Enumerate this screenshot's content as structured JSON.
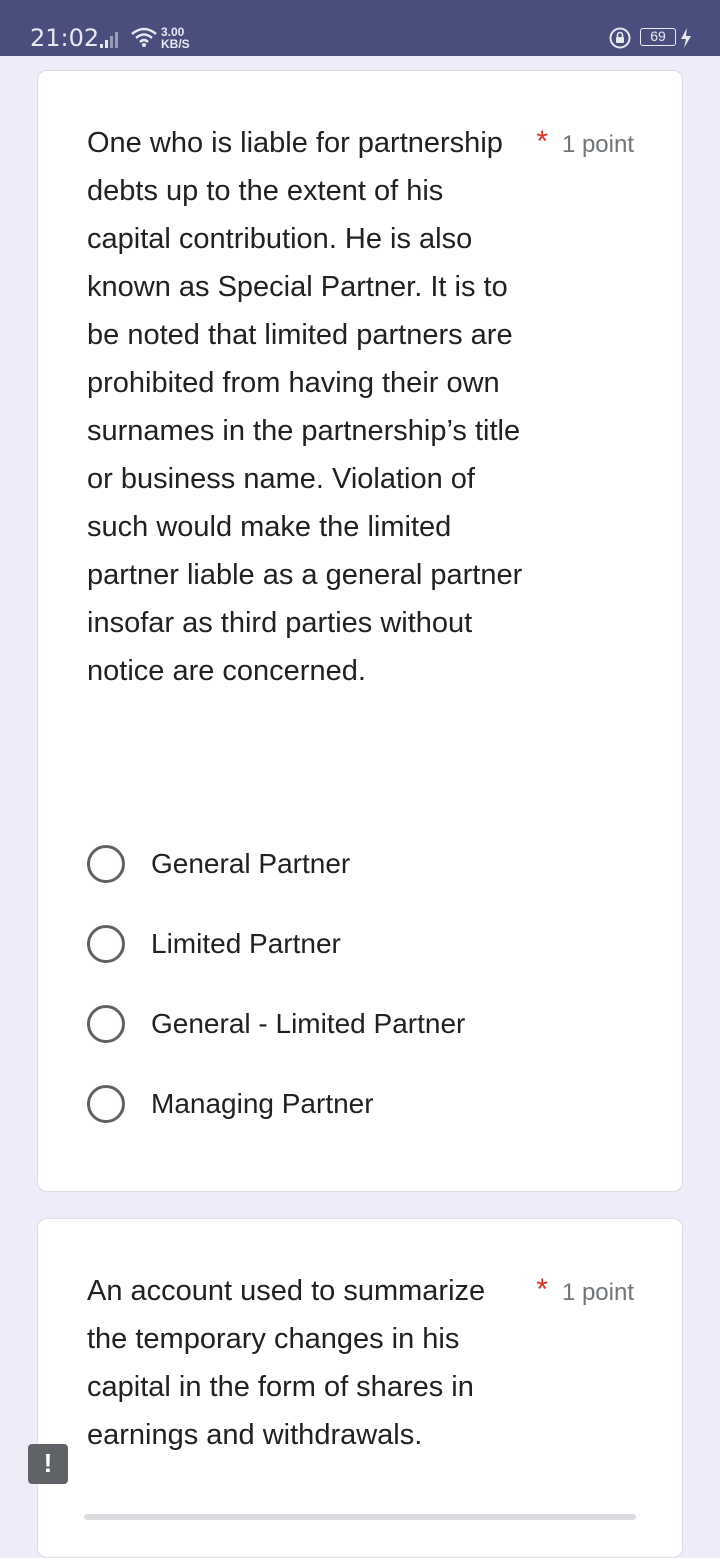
{
  "status_bar": {
    "time": "21:02",
    "network_speed_value": "3.00",
    "network_speed_unit": "KB/S",
    "battery": "69"
  },
  "questions": [
    {
      "text": "One who is liable for partnership debts up to the extent of his capital contribution. He is also known as Special Partner. It is to be noted that limited partners are prohibited from having their own surnames in the partnership’s title or business name. Violation of such would make the limited partner liable as a general partner insofar as third parties without notice are concerned.",
      "required_mark": "*",
      "points": "1 point",
      "options": [
        "General Partner",
        "Limited Partner",
        "General - Limited Partner",
        "Managing Partner"
      ]
    },
    {
      "text": "An account used to summarize the temporary changes in his capital in the form of shares in earnings and withdrawals.",
      "required_mark": "*",
      "points": "1 point"
    }
  ],
  "report_button": "!",
  "colors": {
    "status_bar": "#4a4e7c",
    "background": "#f0ebf8",
    "required": "#d93025"
  }
}
